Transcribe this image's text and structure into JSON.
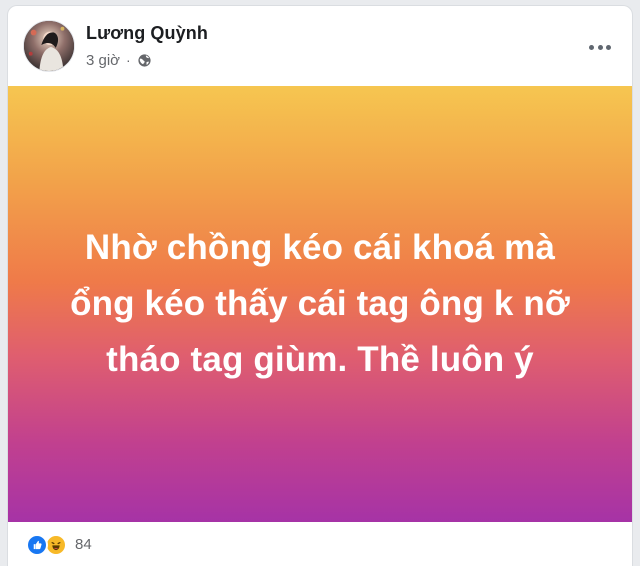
{
  "post": {
    "author": "Lương Quỳnh",
    "timestamp": "3 giờ",
    "separator": "·",
    "privacy_icon": "globe-icon",
    "menu_icon": "more-horizontal-icon",
    "text": "Nhờ chồng kéo cái khoá mà ổng kéo thấy cái tag ông k nỡ tháo tag giùm. Thề luôn ý",
    "background_gradient": [
      "#f6c650",
      "#ef7a49",
      "#a633a6"
    ],
    "reactions": {
      "icons": [
        "like-icon",
        "haha-icon"
      ],
      "count": "84"
    }
  }
}
